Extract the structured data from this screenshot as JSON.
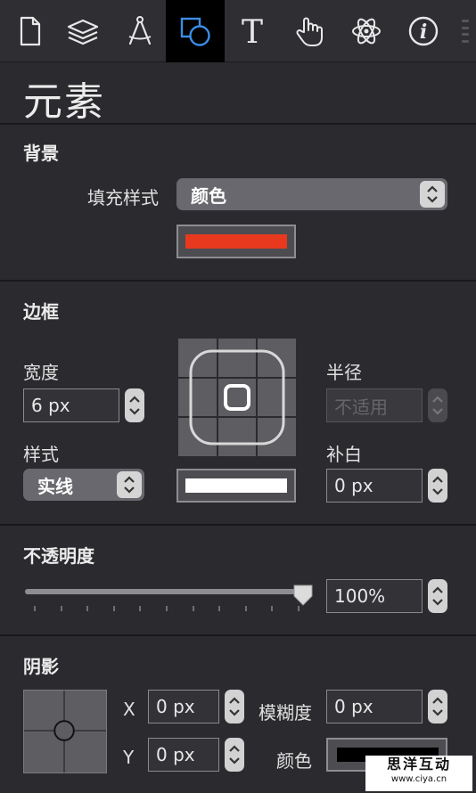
{
  "toolbar": {
    "tools": [
      {
        "icon": "document-icon",
        "active": false
      },
      {
        "icon": "layers-icon",
        "active": false
      },
      {
        "icon": "compass-icon",
        "active": false
      },
      {
        "icon": "shapes-icon",
        "active": true
      },
      {
        "icon": "text-icon",
        "active": false
      },
      {
        "icon": "hand-pointer-icon",
        "active": false
      },
      {
        "icon": "atom-icon",
        "active": false
      },
      {
        "icon": "info-icon",
        "active": false
      }
    ],
    "text_tool_glyph": "T",
    "info_glyph": "i"
  },
  "panel": {
    "title": "元素"
  },
  "background": {
    "label": "背景",
    "fill_style_label": "填充样式",
    "fill_style_value": "颜色",
    "fill_color": "#e8391f"
  },
  "border": {
    "label": "边框",
    "width_label": "宽度",
    "width_value": "6 px",
    "style_label": "样式",
    "style_value": "实线",
    "radius_label": "半径",
    "radius_value": "不适用",
    "padding_label": "补白",
    "padding_value": "0 px",
    "border_color": "#ffffff"
  },
  "opacity": {
    "label": "不透明度",
    "value": "100%",
    "level": 1.0
  },
  "shadow": {
    "label": "阴影",
    "x_label": "X",
    "x_value": "0 px",
    "y_label": "Y",
    "y_value": "0 px",
    "blur_label": "模糊度",
    "blur_value": "0 px",
    "color_label": "颜色",
    "shadow_color": "#000000"
  },
  "watermark": {
    "main": "思洋互动",
    "sub": "www.ciya.cn"
  },
  "colors": {
    "panel_bg": "#2b2a2e",
    "active_tool_bg": "#000000",
    "accent_blue": "#3a8ee6"
  }
}
